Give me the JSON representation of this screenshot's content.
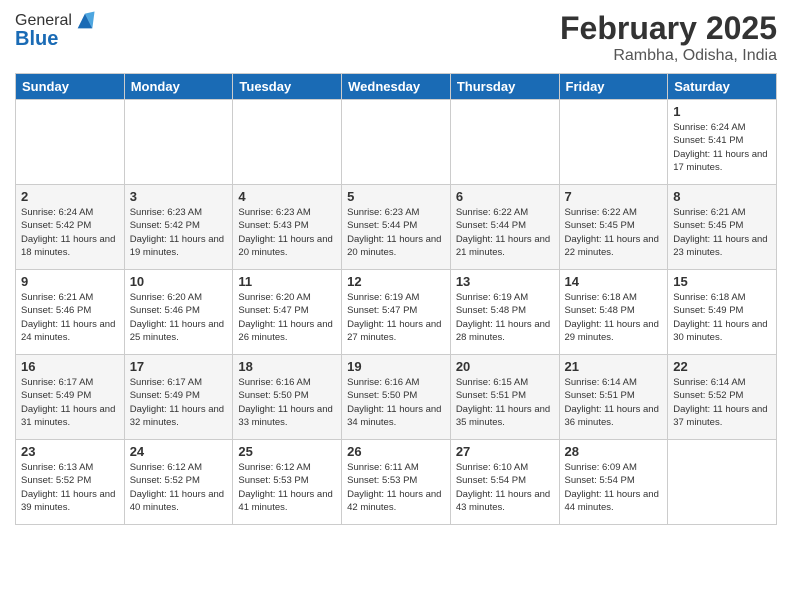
{
  "header": {
    "logo_general": "General",
    "logo_blue": "Blue",
    "month": "February 2025",
    "location": "Rambha, Odisha, India"
  },
  "days_of_week": [
    "Sunday",
    "Monday",
    "Tuesday",
    "Wednesday",
    "Thursday",
    "Friday",
    "Saturday"
  ],
  "weeks": [
    [
      {
        "day": "",
        "info": ""
      },
      {
        "day": "",
        "info": ""
      },
      {
        "day": "",
        "info": ""
      },
      {
        "day": "",
        "info": ""
      },
      {
        "day": "",
        "info": ""
      },
      {
        "day": "",
        "info": ""
      },
      {
        "day": "1",
        "info": "Sunrise: 6:24 AM\nSunset: 5:41 PM\nDaylight: 11 hours and 17 minutes."
      }
    ],
    [
      {
        "day": "2",
        "info": "Sunrise: 6:24 AM\nSunset: 5:42 PM\nDaylight: 11 hours and 18 minutes."
      },
      {
        "day": "3",
        "info": "Sunrise: 6:23 AM\nSunset: 5:42 PM\nDaylight: 11 hours and 19 minutes."
      },
      {
        "day": "4",
        "info": "Sunrise: 6:23 AM\nSunset: 5:43 PM\nDaylight: 11 hours and 20 minutes."
      },
      {
        "day": "5",
        "info": "Sunrise: 6:23 AM\nSunset: 5:44 PM\nDaylight: 11 hours and 20 minutes."
      },
      {
        "day": "6",
        "info": "Sunrise: 6:22 AM\nSunset: 5:44 PM\nDaylight: 11 hours and 21 minutes."
      },
      {
        "day": "7",
        "info": "Sunrise: 6:22 AM\nSunset: 5:45 PM\nDaylight: 11 hours and 22 minutes."
      },
      {
        "day": "8",
        "info": "Sunrise: 6:21 AM\nSunset: 5:45 PM\nDaylight: 11 hours and 23 minutes."
      }
    ],
    [
      {
        "day": "9",
        "info": "Sunrise: 6:21 AM\nSunset: 5:46 PM\nDaylight: 11 hours and 24 minutes."
      },
      {
        "day": "10",
        "info": "Sunrise: 6:20 AM\nSunset: 5:46 PM\nDaylight: 11 hours and 25 minutes."
      },
      {
        "day": "11",
        "info": "Sunrise: 6:20 AM\nSunset: 5:47 PM\nDaylight: 11 hours and 26 minutes."
      },
      {
        "day": "12",
        "info": "Sunrise: 6:19 AM\nSunset: 5:47 PM\nDaylight: 11 hours and 27 minutes."
      },
      {
        "day": "13",
        "info": "Sunrise: 6:19 AM\nSunset: 5:48 PM\nDaylight: 11 hours and 28 minutes."
      },
      {
        "day": "14",
        "info": "Sunrise: 6:18 AM\nSunset: 5:48 PM\nDaylight: 11 hours and 29 minutes."
      },
      {
        "day": "15",
        "info": "Sunrise: 6:18 AM\nSunset: 5:49 PM\nDaylight: 11 hours and 30 minutes."
      }
    ],
    [
      {
        "day": "16",
        "info": "Sunrise: 6:17 AM\nSunset: 5:49 PM\nDaylight: 11 hours and 31 minutes."
      },
      {
        "day": "17",
        "info": "Sunrise: 6:17 AM\nSunset: 5:49 PM\nDaylight: 11 hours and 32 minutes."
      },
      {
        "day": "18",
        "info": "Sunrise: 6:16 AM\nSunset: 5:50 PM\nDaylight: 11 hours and 33 minutes."
      },
      {
        "day": "19",
        "info": "Sunrise: 6:16 AM\nSunset: 5:50 PM\nDaylight: 11 hours and 34 minutes."
      },
      {
        "day": "20",
        "info": "Sunrise: 6:15 AM\nSunset: 5:51 PM\nDaylight: 11 hours and 35 minutes."
      },
      {
        "day": "21",
        "info": "Sunrise: 6:14 AM\nSunset: 5:51 PM\nDaylight: 11 hours and 36 minutes."
      },
      {
        "day": "22",
        "info": "Sunrise: 6:14 AM\nSunset: 5:52 PM\nDaylight: 11 hours and 37 minutes."
      }
    ],
    [
      {
        "day": "23",
        "info": "Sunrise: 6:13 AM\nSunset: 5:52 PM\nDaylight: 11 hours and 39 minutes."
      },
      {
        "day": "24",
        "info": "Sunrise: 6:12 AM\nSunset: 5:52 PM\nDaylight: 11 hours and 40 minutes."
      },
      {
        "day": "25",
        "info": "Sunrise: 6:12 AM\nSunset: 5:53 PM\nDaylight: 11 hours and 41 minutes."
      },
      {
        "day": "26",
        "info": "Sunrise: 6:11 AM\nSunset: 5:53 PM\nDaylight: 11 hours and 42 minutes."
      },
      {
        "day": "27",
        "info": "Sunrise: 6:10 AM\nSunset: 5:54 PM\nDaylight: 11 hours and 43 minutes."
      },
      {
        "day": "28",
        "info": "Sunrise: 6:09 AM\nSunset: 5:54 PM\nDaylight: 11 hours and 44 minutes."
      },
      {
        "day": "",
        "info": ""
      }
    ]
  ]
}
